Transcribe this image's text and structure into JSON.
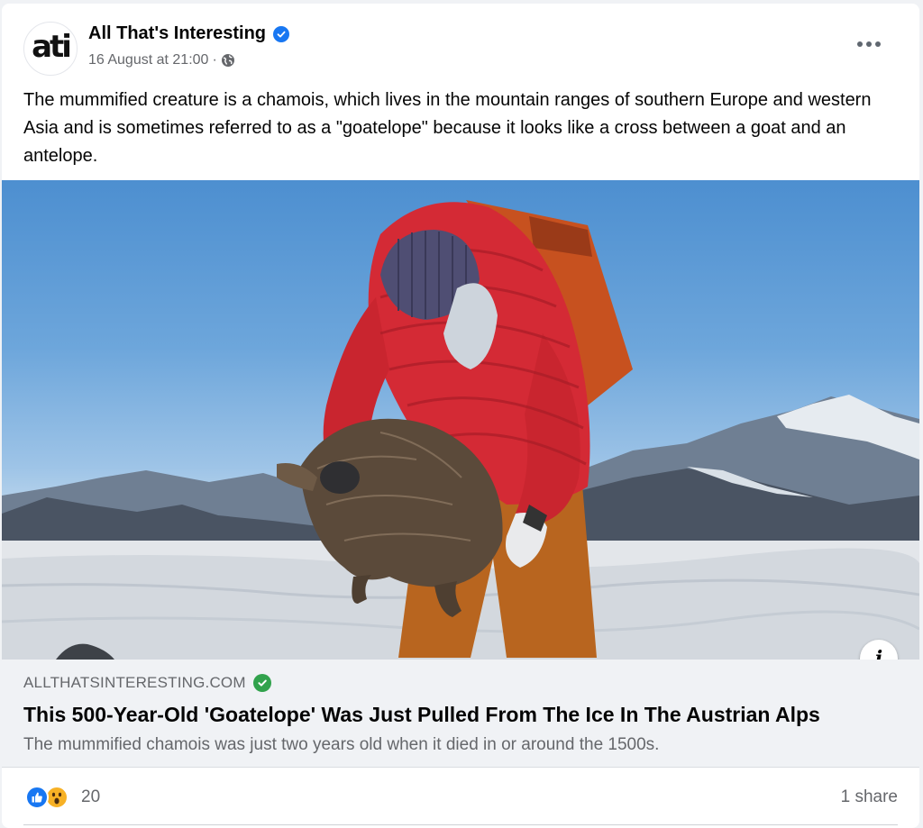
{
  "post": {
    "page_name": "All That's Interesting",
    "avatar_text": "ati",
    "timestamp": "16 August at 21:00",
    "separator": "·",
    "audience_icon": "globe-icon",
    "more_icon": "more-options-icon",
    "verified_icon": "verified-badge-icon",
    "body": "The mummified creature is a chamois, which lives in the mountain ranges of southern Europe and western Asia and is sometimes referred to as a \"goatelope\" because it looks like a cross between a goat and an antelope."
  },
  "link_preview": {
    "domain": "ALLTHATSINTERESTING.COM",
    "domain_verified_icon": "verified-check-icon",
    "title": "This 500-Year-Old 'Goatelope' Was Just Pulled From The Ice In The Austrian Alps",
    "description": "The mummified chamois was just two years old when it died in or around the 1500s.",
    "info_label": "i"
  },
  "engagement": {
    "reaction_icons": [
      "like-reaction-icon",
      "wow-reaction-icon"
    ],
    "reaction_count": "20",
    "shares": "1 share"
  },
  "colors": {
    "accent_blue": "#1877f2",
    "verified_green": "#31a24c",
    "secondary_text": "#65676b",
    "jacket_red": "#d42a35"
  }
}
